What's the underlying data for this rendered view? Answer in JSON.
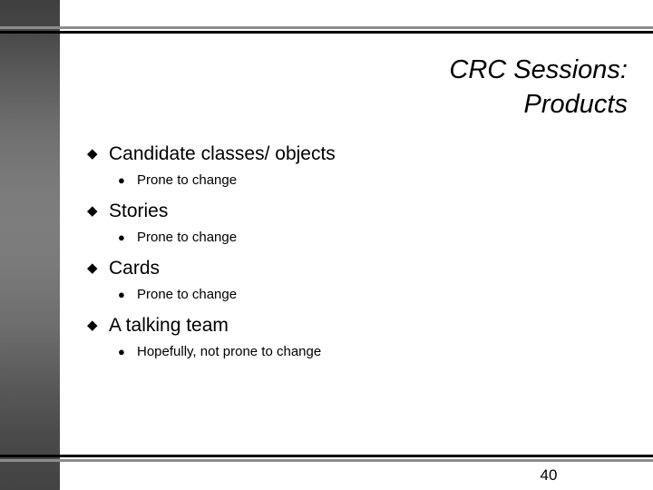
{
  "slide": {
    "title_lines": [
      "CRC Sessions:",
      "Products"
    ],
    "page_number": "40",
    "markers": {
      "level1": "◆",
      "level2": "●"
    },
    "colors": {
      "background": "#ffffff",
      "text": "#000000",
      "rule_gray": "#8c8c8c",
      "rule_black": "#000000",
      "sidebar_dark": "#434343",
      "sidebar_light": "#7d7d7d"
    },
    "bullets": [
      {
        "level1": "Candidate classes/ objects",
        "level2": "Prone to change"
      },
      {
        "level1": "Stories",
        "level2": "Prone to change"
      },
      {
        "level1": "Cards",
        "level2": "Prone to change"
      },
      {
        "level1": "A talking team",
        "level2": "Hopefully, not prone to change"
      }
    ]
  }
}
